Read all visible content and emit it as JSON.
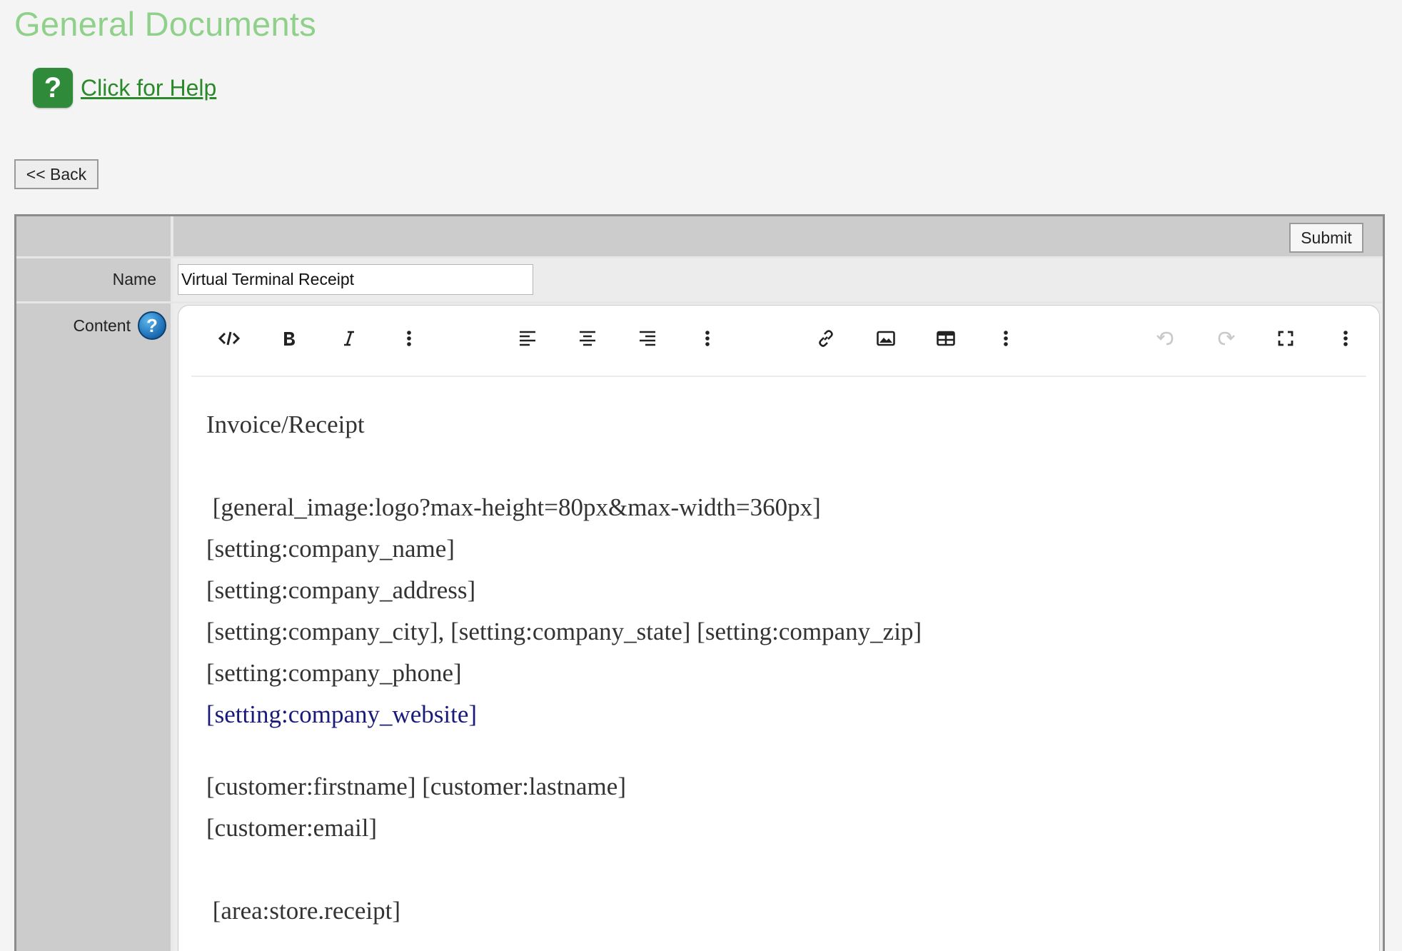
{
  "page": {
    "title": "General Documents",
    "help_link": "Click for Help",
    "help_badge": "?",
    "back_label": "<< Back"
  },
  "form": {
    "submit_label": "Submit",
    "name_label": "Name",
    "name_value": "Virtual Terminal Receipt",
    "content_label": "Content",
    "content_info_glyph": "?"
  },
  "toolbar": {
    "buttons": [
      "source-code",
      "bold",
      "italic",
      "more",
      "align-left",
      "align-center",
      "align-right",
      "more",
      "link",
      "image",
      "table",
      "more",
      "undo",
      "redo",
      "fullscreen",
      "more"
    ],
    "disabled": [
      "undo",
      "redo"
    ]
  },
  "content": {
    "heading": "Invoice/Receipt",
    "logo_tag": " [general_image:logo?max-height=80px&max-width=360px]",
    "company_name": "[setting:company_name]",
    "company_address": "[setting:company_address]",
    "company_city_line": "[setting:company_city], [setting:company_state] [setting:company_zip]",
    "company_phone": "[setting:company_phone]",
    "company_website": "[setting:company_website]",
    "customer_name": "[customer:firstname] [customer:lastname]",
    "customer_email": "[customer:email]",
    "store_receipt": " [area:store.receipt]"
  },
  "colors": {
    "title_green": "#8fd18a",
    "help_green": "#2f8a3a",
    "link_blue": "#1a1a7a"
  }
}
